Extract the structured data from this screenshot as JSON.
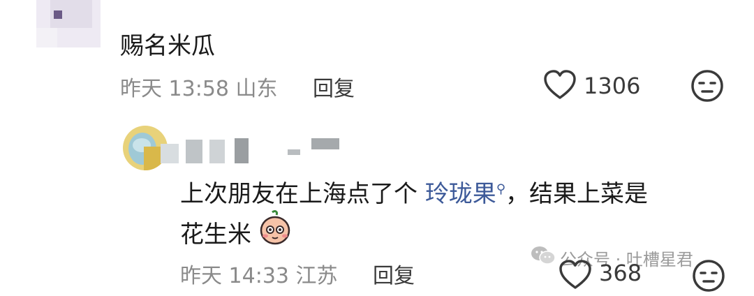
{
  "comment1": {
    "text": "赐名米瓜",
    "time": "昨天 13:58",
    "location": "山东",
    "reply_label": "回复",
    "likes": "1306"
  },
  "comment2": {
    "text_before": "上次朋友在上海点了个",
    "link_text": "玲珑果",
    "text_after": "，结果上菜是",
    "text_line2": "花生米",
    "time": "昨天 14:33",
    "location": "江苏",
    "reply_label": "回复",
    "likes": "368"
  },
  "watermark": "公众号 · 吐槽星君",
  "icons": {
    "like": "heart-outline-icon",
    "emoji_react": "neutral-face-icon",
    "search": "search-icon",
    "wechat": "wechat-icon",
    "sticker": "peanut-sticker-icon"
  }
}
